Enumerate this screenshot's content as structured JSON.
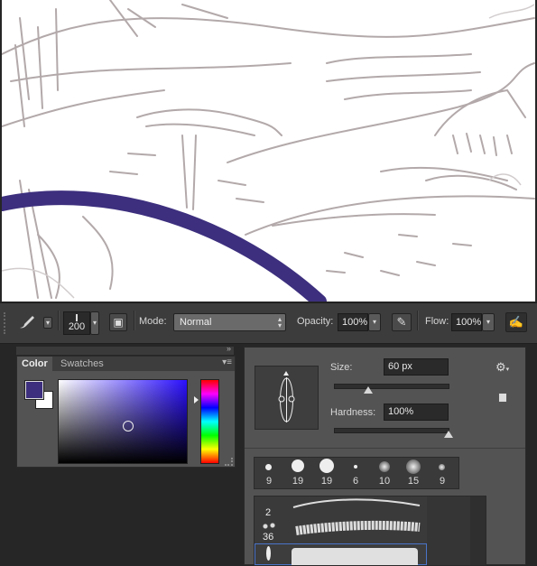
{
  "canvas": {
    "stroke_color": "#3d2f7e",
    "sketch_color": "#b3a9aa"
  },
  "options_bar": {
    "brush_size": "200",
    "mode_label": "Mode:",
    "mode_value": "Normal",
    "opacity_label": "Opacity:",
    "opacity_value": "100%",
    "flow_label": "Flow:",
    "flow_value": "100%"
  },
  "color_panel": {
    "tabs": [
      {
        "label": "Color"
      },
      {
        "label": "Swatches"
      }
    ],
    "foreground_color": "#3d2f7e",
    "background_color": "#ffffff",
    "hue_color": "#2b10ff"
  },
  "brush_panel": {
    "size_label": "Size:",
    "size_value": "60 px",
    "hardness_label": "Hardness:",
    "hardness_value": "100%",
    "size_fraction": 0.29,
    "hardness_fraction": 1.0,
    "presets": [
      {
        "value": "9"
      },
      {
        "value": "19"
      },
      {
        "value": "19"
      },
      {
        "value": "6"
      },
      {
        "value": "10"
      },
      {
        "value": "15"
      },
      {
        "value": "9"
      }
    ],
    "brush_list": [
      {
        "value": "2"
      },
      {
        "value": "36"
      }
    ]
  }
}
